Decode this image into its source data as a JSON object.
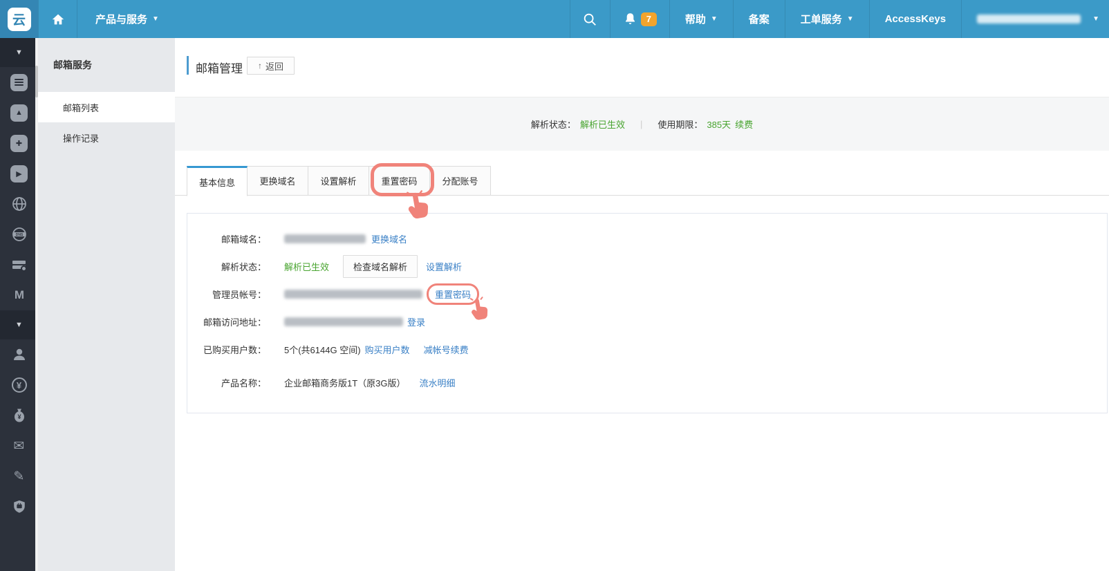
{
  "topnav": {
    "products_label": "产品与服务",
    "notification_count": "7",
    "help_label": "帮助",
    "beian_label": "备案",
    "ticket_label": "工单服务",
    "accesskeys_label": "AccessKeys"
  },
  "sidebar_icons": {
    "top_group": [
      "collapse-chevron-icon",
      "server-list-icon",
      "api-app-icon",
      "node-plus-icon",
      "promotion-icon",
      "network-globe-icon",
      "dns-globe-icon",
      "storage-servers-icon",
      "m-service-icon"
    ],
    "bottom_group": [
      "collapse-chevron-icon",
      "user-icon",
      "billing-yen-icon",
      "money-bag-icon",
      "mail-envelope-icon",
      "edit-pencil-icon",
      "security-shield-icon"
    ]
  },
  "subnav": {
    "header": "邮箱服务",
    "items": [
      {
        "label": "邮箱列表",
        "active": true
      },
      {
        "label": "操作记录",
        "active": false
      }
    ]
  },
  "page": {
    "title": "邮箱管理",
    "back_label": "返回"
  },
  "statusbar": {
    "resolve_label": "解析状态：",
    "resolve_value": "解析已生效",
    "divider": "|",
    "period_label": "使用期限：",
    "period_value": "385天",
    "renew_label": "续费"
  },
  "tabs": [
    {
      "label": "基本信息",
      "active": true
    },
    {
      "label": "更换域名",
      "active": false
    },
    {
      "label": "设置解析",
      "active": false
    },
    {
      "label": "重置密码",
      "active": false,
      "annotated": true
    },
    {
      "label": "分配账号",
      "active": false
    }
  ],
  "panel": {
    "rows": [
      {
        "label": "邮箱域名：",
        "link1": "更换域名"
      },
      {
        "label": "解析状态：",
        "value": "解析已生效",
        "button": "检查域名解析",
        "link1": "设置解析"
      },
      {
        "label": "管理员帐号：",
        "link1": "重置密码"
      },
      {
        "label": "邮箱访问地址：",
        "link1": "登录"
      },
      {
        "label": "已购买用户数：",
        "value": "5个(共6144G 空间)",
        "link1": "购买用户数",
        "link2": "减帐号续费"
      },
      {
        "label": "产品名称：",
        "value": "企业邮箱商务版1T（原3G版）",
        "link1": "流水明细"
      }
    ]
  },
  "colors": {
    "nav_blue": "#3b9ac8",
    "nav_blue_dark": "#3486b4",
    "sidebar_dark": "#2c313b",
    "status_green": "#48a42f",
    "link_blue": "#3a80c6",
    "annotation_salmon": "#f0837a",
    "badge_orange": "#f2a42c"
  }
}
